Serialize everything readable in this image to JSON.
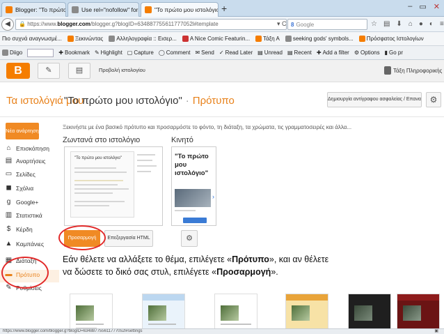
{
  "browser": {
    "tabs": [
      {
        "label": "Blogger: \"Το πρώτο μου ι...",
        "active": false
      },
      {
        "label": "Use rel=\"nofollow\" for spe...",
        "active": false
      },
      {
        "label": "\"Το πρώτο μου ιστολόγιο\"",
        "active": true
      }
    ],
    "new_tab": "+",
    "url_prefix": "https://www.",
    "url_domain": "blogger.com",
    "url_rest": "/blogger.g?blogID=634887755611777052l#template",
    "search_placeholder": "Google",
    "bookmarks": [
      "Πιο συχνά αναγνωσμέ...",
      "Ξεκινώντας",
      "Αλληλογραφία :: Εισερ...",
      "A Nice Comic Featurin...",
      "Τάξη Α",
      "seeking gods' symbols...",
      "Πρόσφατος Ιστολογίων"
    ],
    "addons": [
      "Diigo",
      "Bookmark",
      "Highlight",
      "Capture",
      "Comment",
      "Send",
      "Read Later",
      "Unread",
      "Recent",
      "Add a filter",
      "Options",
      "Go pr"
    ],
    "status_url": "https://www.blogger.com/blogger.g?blogID=634887755611777052l#settings"
  },
  "app": {
    "logo": "B",
    "view_blog": "Προβολή ιστολογίου",
    "user_name": "Τάξη Πληροφορικής",
    "my_blogs": "Τα ιστολόγιά μου",
    "blog_title": "\"Το πρώτο μου ιστολόγιο\"",
    "title_sep": "·",
    "section": "Πρότυπο",
    "backup_button": "Δημιουργία αντίγραφου ασφαλείας / Επαναφορά",
    "new_post": "Νέα ανάρτηση",
    "sidebar": [
      {
        "label": "Επισκόπηση",
        "icon": "home-icon"
      },
      {
        "label": "Αναρτήσεις",
        "icon": "posts-icon"
      },
      {
        "label": "Σελίδες",
        "icon": "pages-icon"
      },
      {
        "label": "Σχόλια",
        "icon": "comments-icon"
      },
      {
        "label": "Google+",
        "icon": "google-plus-icon"
      },
      {
        "label": "Στατιστικά",
        "icon": "stats-icon"
      },
      {
        "label": "Κέρδη",
        "icon": "earnings-icon"
      },
      {
        "label": "Καμπάνιες",
        "icon": "campaigns-icon"
      },
      {
        "label": "Διάταξη",
        "icon": "layout-icon"
      },
      {
        "label": "Πρότυπο",
        "icon": "template-icon"
      },
      {
        "label": "Ρυθμίσεις",
        "icon": "settings-icon"
      }
    ],
    "intro": "Ξεκινήστε με ένα βασικό πρότυπο και προσαρμόστε το φόντο, τη διάταξη, τα χρώματα, τις γραμματοσειρές και άλλα...",
    "live_heading": "Ζωντανά στο ιστολόγιο",
    "mobile_heading": "Κινητό",
    "preview_title": "\"Το πρώτο μου ιστολόγιο\"",
    "mobile_preview_title": "\"Το πρώτο μου ιστολόγιο\"",
    "customize_button": "Προσαρμογή",
    "edit_html_button": "Επεξεργασία HTML"
  },
  "caption": {
    "part1": "Εάν θέλετε να αλλάξετε το θέμα, επιλέγετε «",
    "bold1": "Πρότυπο",
    "part2": "», και αν θέλετε να δώσετε το δικό σας στυλ, επιλέγετε «",
    "bold2": "Προσαρμογή",
    "part3": "»."
  },
  "colors": {
    "accent": "#f08a24",
    "highlight_circle": "#e22a2a"
  }
}
